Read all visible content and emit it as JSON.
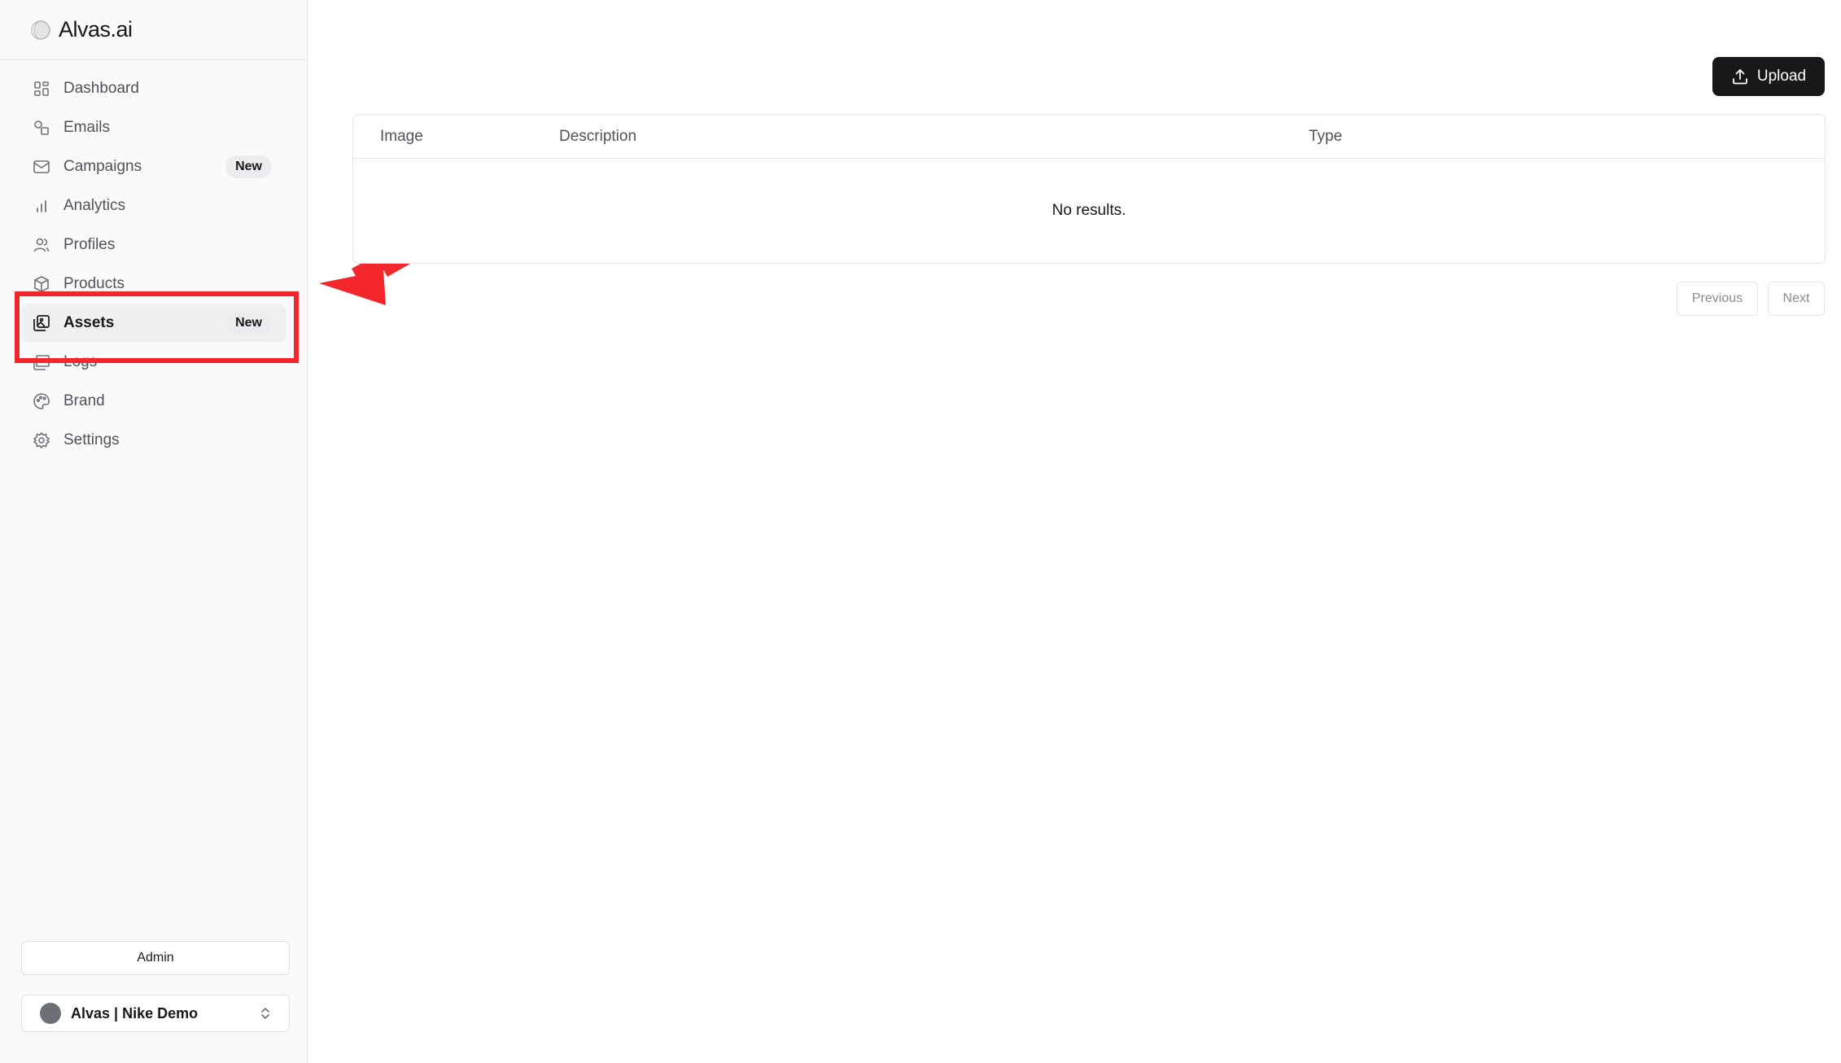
{
  "brand": {
    "name": "Alvas.ai",
    "logo_icon": "moon-logo-icon"
  },
  "sidebar": {
    "items": [
      {
        "label": "Dashboard",
        "icon": "dashboard-grid-icon"
      },
      {
        "label": "Emails",
        "icon": "emails-shapes-icon"
      },
      {
        "label": "Campaigns",
        "icon": "mail-envelope-icon",
        "badge": "New"
      },
      {
        "label": "Analytics",
        "icon": "bar-chart-icon"
      },
      {
        "label": "Profiles",
        "icon": "users-icon"
      },
      {
        "label": "Products",
        "icon": "package-icon"
      },
      {
        "label": "Assets",
        "icon": "image-gallery-icon",
        "badge": "New",
        "active": true
      },
      {
        "label": "Logs",
        "icon": "logs-icon"
      },
      {
        "label": "Brand",
        "icon": "palette-icon"
      },
      {
        "label": "Settings",
        "icon": "gear-icon"
      }
    ],
    "admin_label": "Admin",
    "account": {
      "name": "Alvas | Nike Demo",
      "chevron_icon": "chevrons-up-down-icon"
    }
  },
  "toolbar": {
    "upload_label": "Upload",
    "upload_icon": "upload-icon"
  },
  "table": {
    "columns": [
      "Image",
      "Description",
      "Type"
    ],
    "empty_text": "No results."
  },
  "pagination": {
    "previous_label": "Previous",
    "next_label": "Next"
  },
  "annotation": {
    "color": "#f2262b"
  },
  "colors": {
    "primary": "#18181b",
    "sidebar_bg": "#fafafa",
    "highlight": "#f2262b"
  }
}
